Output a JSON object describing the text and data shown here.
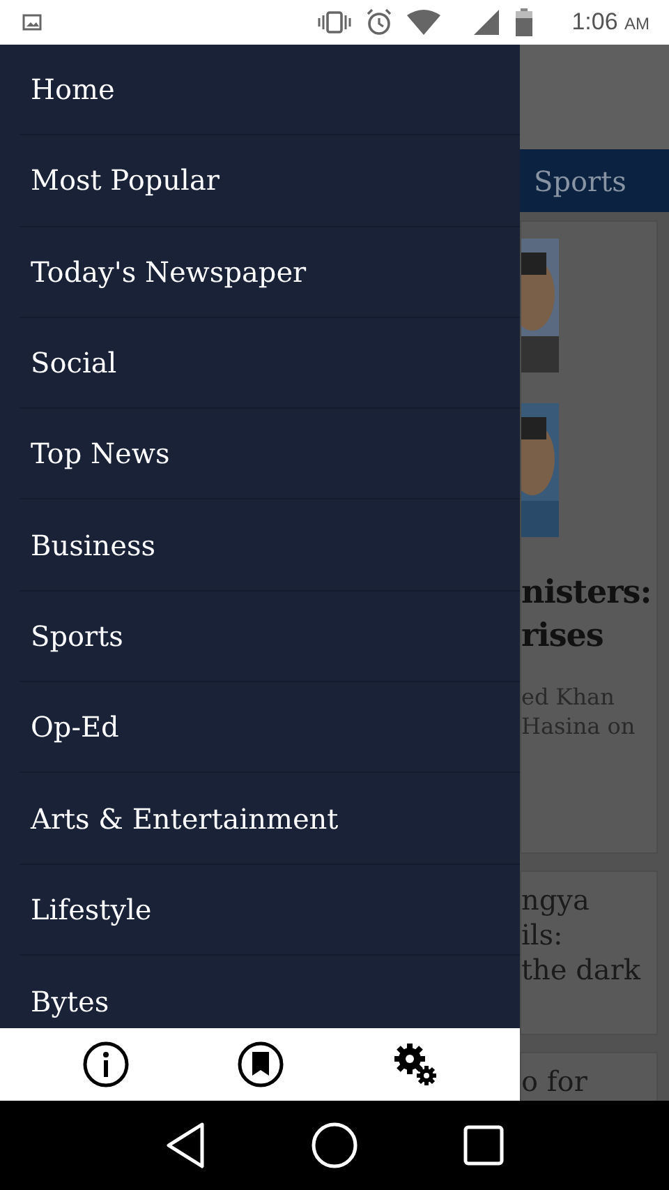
{
  "status_bar": {
    "time": "1:06",
    "ampm": "AM"
  },
  "drawer": {
    "items": [
      {
        "label": "Home"
      },
      {
        "label": "Most Popular"
      },
      {
        "label": "Today's Newspaper"
      },
      {
        "label": "Social"
      },
      {
        "label": "Top News"
      },
      {
        "label": "Business"
      },
      {
        "label": "Sports"
      },
      {
        "label": "Op-Ed"
      },
      {
        "label": "Arts & Entertainment"
      },
      {
        "label": "Lifestyle"
      },
      {
        "label": "Bytes"
      }
    ]
  },
  "background": {
    "tab": "Sports",
    "cards": [
      {
        "kind": "photos",
        "headline": [
          "nisters:",
          "rises"
        ],
        "summary": [
          "ed Khan",
          "Hasina on"
        ]
      },
      {
        "kind": "text",
        "headline": [
          "ngya",
          "ils:",
          "the dark"
        ]
      },
      {
        "kind": "text",
        "headline": [
          "o for"
        ]
      }
    ]
  }
}
